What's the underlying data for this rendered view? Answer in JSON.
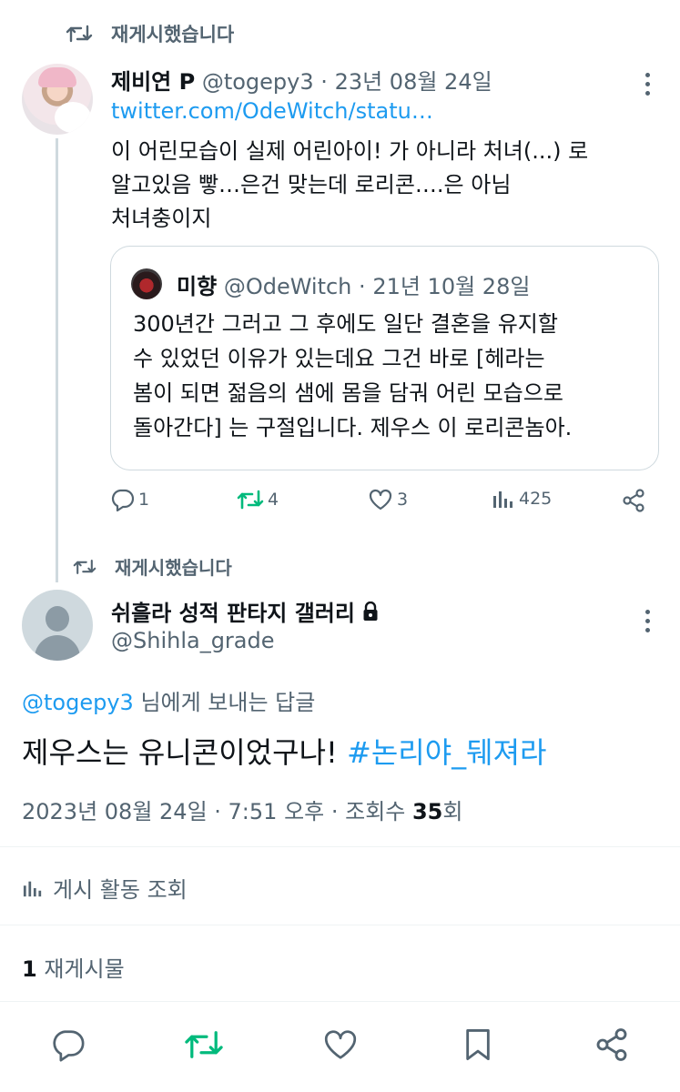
{
  "repost_banner_top": {
    "label": "재게시했습니다"
  },
  "tweet1": {
    "name": "제비연 P",
    "handle": "@togepy3",
    "sep": "·",
    "date": "23년 08월 24일",
    "link": "twitter.com/OdeWitch/statu…",
    "body_lines": [
      "이 어린모습이 실제 어린아이! 가 아니라 처녀(...) 로",
      "알고있음 빻…은건 맞는데 로리콘….은 아님",
      "처녀충이지"
    ],
    "quote": {
      "name": "미향",
      "handle": "@OdeWitch",
      "sep": "·",
      "date": "21년 10월 28일",
      "body_lines": [
        "300년간 그러고 그 후에도 일단 결혼을 유지할",
        "수 있었던 이유가 있는데요 그건 바로 [헤라는",
        "봄이 되면 젊음의 샘에 몸을 담궈 어린 모습으로",
        "돌아간다] 는 구절입니다. 제우스 이 로리콘놈아."
      ]
    },
    "actions": {
      "replies": "1",
      "reposts": "4",
      "likes": "3",
      "views": "425"
    }
  },
  "repost_banner_mid": {
    "label": "재게시했습니다"
  },
  "tweet2": {
    "name": "쉬흘라 성적 판타지 갤러리",
    "handle": "@Shihla_grade",
    "reply_to_handle": "@togepy3",
    "reply_to_suffix": " 님에게 보내는 답글",
    "text_plain": "제우스는 유니콘이었구나! ",
    "hashtag": "#논리야_뒈져라",
    "meta_prefix": "2023년 08월 24일 · 7:51 오후 · 조회수 ",
    "meta_views": "35",
    "meta_suffix": "회",
    "activity_label": "게시 활동 조회",
    "repost_count": "1",
    "repost_count_label": " 재게시물"
  },
  "colors": {
    "accent": "#1d9bf0",
    "repost_green": "#00ba7c",
    "muted": "#536471",
    "text": "#0f1419"
  }
}
